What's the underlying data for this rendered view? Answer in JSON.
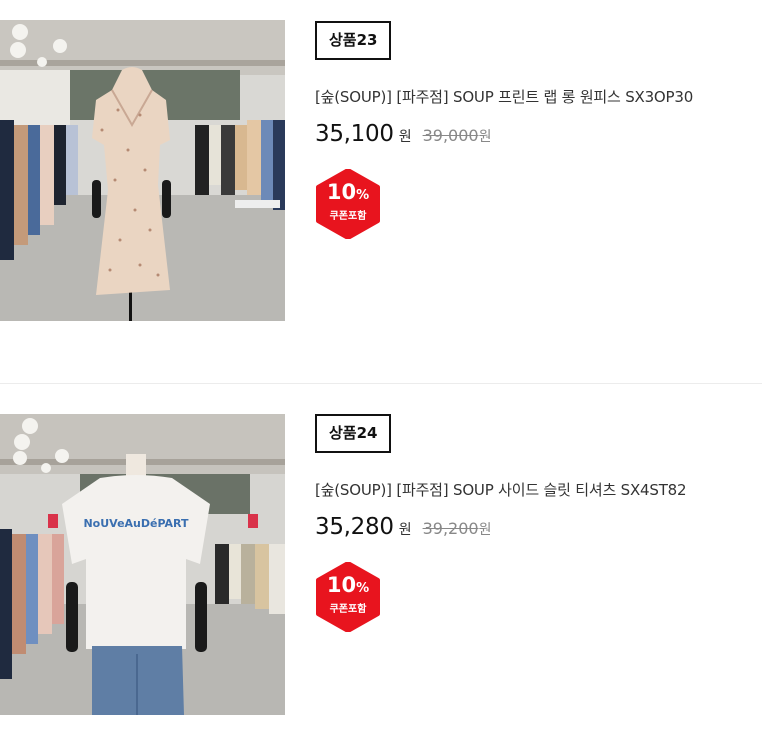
{
  "products": [
    {
      "badge": "상품23",
      "name": "[숲(SOUP)] [파주점] SOUP 프린트 랩 롱 원피스 SX3OP30",
      "price": "35,100",
      "price_unit": "원",
      "original_price": "39,000",
      "original_unit": "원",
      "discount_percent": "10",
      "discount_symbol": "%",
      "coupon_label": "쿠폰포함"
    },
    {
      "badge": "상품24",
      "name": "[숲(SOUP)] [파주점] SOUP 사이드 슬릿 티셔츠 SX4ST82",
      "price": "35,280",
      "price_unit": "원",
      "original_price": "39,200",
      "original_unit": "원",
      "discount_percent": "10",
      "discount_symbol": "%",
      "coupon_label": "쿠폰포함"
    }
  ],
  "colors": {
    "coupon_red": "#e8141e",
    "badge_border": "#111111",
    "strike_gray": "#888888"
  }
}
